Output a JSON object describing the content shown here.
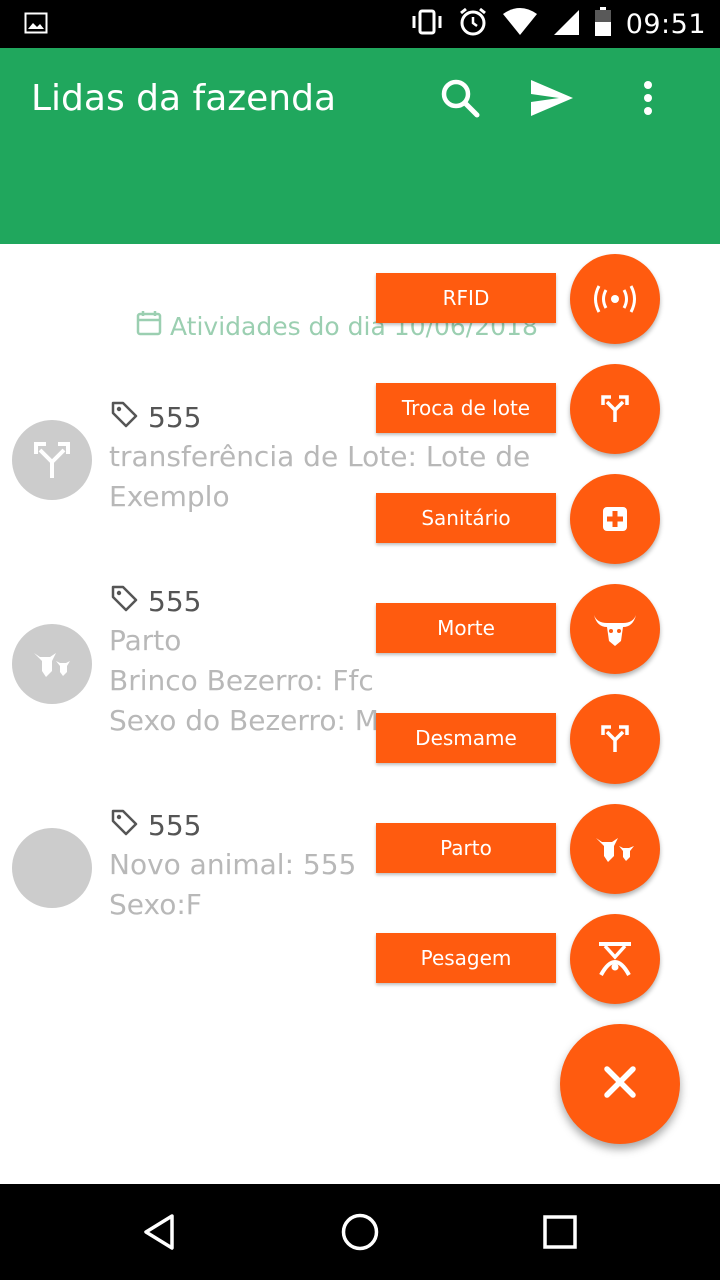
{
  "status_bar": {
    "time": "09:51"
  },
  "app_bar": {
    "title": "Lidas da fazenda",
    "color": "#20a75d"
  },
  "content": {
    "date_heading": "Atividades do dia 10/06/2018",
    "entries": [
      {
        "tag": "555",
        "lines": [
          "transferência de Lote: Lote de",
          "Exemplo"
        ],
        "icon": "branch-icon"
      },
      {
        "tag": "555",
        "lines": [
          "Parto",
          "Brinco Bezerro: Ffc",
          "Sexo do Bezerro: M"
        ],
        "icon": "cow-calf-icon"
      },
      {
        "tag": "555",
        "lines": [
          "Novo animal: 555",
          "Sexo:F"
        ],
        "icon": "blank-avatar"
      }
    ]
  },
  "speed_dial": {
    "accent": "#ff5b0f",
    "actions": [
      {
        "label": "RFID",
        "icon": "rfid-icon"
      },
      {
        "label": "Troca de lote",
        "icon": "branch-icon"
      },
      {
        "label": "Sanitário",
        "icon": "medical-plus-icon"
      },
      {
        "label": "Morte",
        "icon": "bull-skull-icon"
      },
      {
        "label": "Desmame",
        "icon": "branch-icon"
      },
      {
        "label": "Parto",
        "icon": "cow-calf-icon"
      },
      {
        "label": "Pesagem",
        "icon": "scale-icon"
      }
    ],
    "main_icon": "close-icon"
  },
  "nav_bar": {
    "buttons": [
      "back",
      "home",
      "recents"
    ]
  }
}
